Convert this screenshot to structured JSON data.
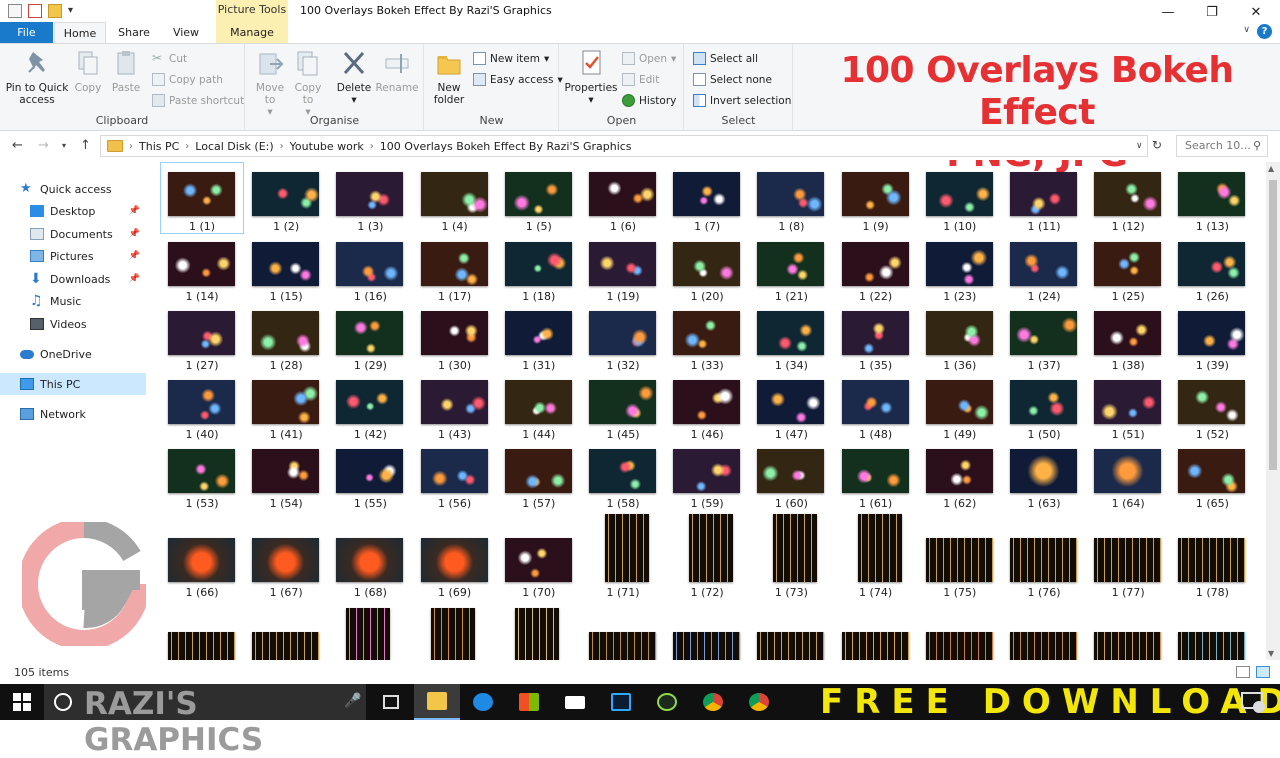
{
  "window": {
    "title": "100 Overlays Bokeh Effect By  Razi'S Graphics",
    "contextual_group": "Picture Tools"
  },
  "tabs": [
    "File",
    "Home",
    "Share",
    "View",
    "Manage"
  ],
  "ribbon": {
    "clipboard": {
      "label": "Clipboard",
      "pin": "Pin to Quick access",
      "copy": "Copy",
      "paste": "Paste",
      "cut": "Cut",
      "copy_path": "Copy path",
      "paste_shortcut": "Paste shortcut"
    },
    "organise": {
      "label": "Organise",
      "move_to": "Move to",
      "copy_to": "Copy to",
      "delete": "Delete",
      "rename": "Rename"
    },
    "new": {
      "label": "New",
      "new_folder": "New folder",
      "new_item": "New item",
      "easy_access": "Easy access"
    },
    "open": {
      "label": "Open",
      "properties": "Properties",
      "open": "Open",
      "edit": "Edit",
      "history": "History"
    },
    "select": {
      "label": "Select",
      "select_all": "Select all",
      "select_none": "Select none",
      "invert": "Invert selection"
    }
  },
  "address": {
    "crumbs": [
      "This PC",
      "Local Disk (E:)",
      "Youtube work",
      "100 Overlays Bokeh Effect By  Razi'S Graphics"
    ],
    "search_placeholder": "Search 10..."
  },
  "nav": {
    "quick_access": "Quick access",
    "pinned": [
      "Desktop",
      "Documents",
      "Pictures",
      "Downloads"
    ],
    "unpinned": [
      "Music",
      "Videos"
    ],
    "onedrive": "OneDrive",
    "this_pc": "This PC",
    "network": "Network"
  },
  "files": {
    "labels": [
      "1 (1)",
      "1 (2)",
      "1 (3)",
      "1 (4)",
      "1 (5)",
      "1 (6)",
      "1 (7)",
      "1 (8)",
      "1 (9)",
      "1 (10)",
      "1 (11)",
      "1 (12)",
      "1 (13)",
      "1 (14)",
      "1 (15)",
      "1 (16)",
      "1 (17)",
      "1 (18)",
      "1 (19)",
      "1 (20)",
      "1 (21)",
      "1 (22)",
      "1 (23)",
      "1 (24)",
      "1 (25)",
      "1 (26)",
      "1 (27)",
      "1 (28)",
      "1 (29)",
      "1 (30)",
      "1 (31)",
      "1 (32)",
      "1 (33)",
      "1 (34)",
      "1 (35)",
      "1 (36)",
      "1 (37)",
      "1 (38)",
      "1 (39)",
      "1 (40)",
      "1 (41)",
      "1 (42)",
      "1 (43)",
      "1 (44)",
      "1 (45)",
      "1 (46)",
      "1 (47)",
      "1 (48)",
      "1 (49)",
      "1 (50)",
      "1 (51)",
      "1 (52)",
      "1 (53)",
      "1 (54)",
      "1 (55)",
      "1 (56)",
      "1 (57)",
      "1 (58)",
      "1 (59)",
      "1 (60)",
      "1 (61)",
      "1 (62)",
      "1 (63)",
      "1 (64)",
      "1 (65)",
      "1 (66)",
      "1 (67)",
      "1 (68)",
      "1 (69)",
      "1 (70)",
      "1 (71)",
      "1 (72)",
      "1 (73)",
      "1 (74)",
      "1 (75)",
      "1 (76)",
      "1 (77)",
      "1 (78)"
    ],
    "count": "105 items"
  },
  "overlay": {
    "headline_line1": "100 Overlays Bokeh Effect",
    "headline_line2": "PNG, JPG",
    "brand": "RAZI'S GRAPHICS",
    "cta": "FREE DOWNLOAD"
  },
  "colors": {
    "accent": "#1979ca",
    "headline": "#e53034",
    "cta": "#f2e60a",
    "manage_tab": "#fcefb2"
  }
}
